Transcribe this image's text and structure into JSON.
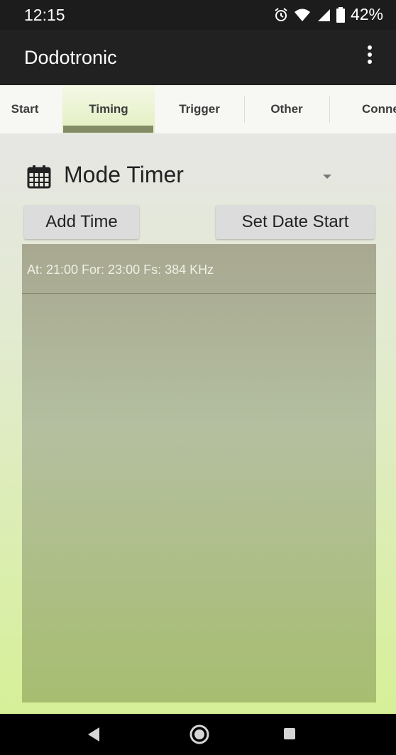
{
  "status_bar": {
    "time": "12:15",
    "battery": "42%",
    "icons": [
      "alarm-icon",
      "wifi-icon",
      "signal-icon",
      "battery-icon"
    ]
  },
  "app_bar": {
    "title": "Dodotronic",
    "menu_icon": "overflow-menu-icon"
  },
  "tabs": [
    {
      "label": "Start"
    },
    {
      "label": "Timing",
      "selected": true
    },
    {
      "label": "Trigger"
    },
    {
      "label": "Other"
    },
    {
      "label": "Conne"
    }
  ],
  "mode": {
    "icon": "calendar-icon",
    "label": "Mode Timer"
  },
  "buttons": {
    "add_time": "Add Time",
    "set_date_start": "Set Date Start"
  },
  "schedule": {
    "items": [
      {
        "text": "At: 21:00 For: 23:00 Fs: 384 KHz"
      }
    ]
  },
  "colors": {
    "tab_indicator": "#838c66",
    "app_bar": "#212121",
    "list_bg": "#a8b590"
  }
}
